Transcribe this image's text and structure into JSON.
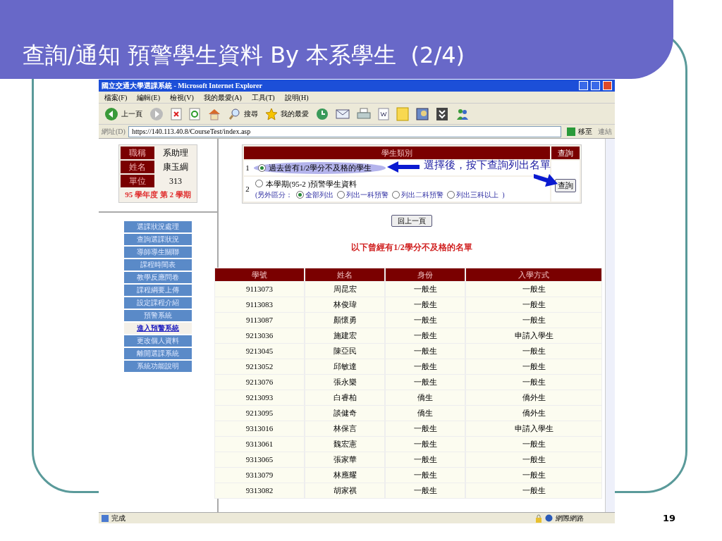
{
  "slide": {
    "title": "查詢/通知 預警學生資料 By 本系學生  (2/4)",
    "page_number": "19"
  },
  "browser": {
    "title": "國立交通大學選課系統 - Microsoft Internet Explorer",
    "menu": [
      "檔案(F)",
      "編輯(E)",
      "檢視(V)",
      "我的最愛(A)",
      "工具(T)",
      "說明(H)"
    ],
    "toolbar": [
      {
        "kind": "back",
        "label": "上一頁"
      },
      {
        "kind": "forward"
      },
      {
        "kind": "stop"
      },
      {
        "kind": "refresh"
      },
      {
        "kind": "home"
      },
      {
        "kind": "search",
        "label": "搜尋"
      },
      {
        "kind": "favorites",
        "label": "我的最愛"
      },
      {
        "kind": "history"
      },
      {
        "kind": "mail"
      },
      {
        "kind": "print"
      },
      {
        "kind": "edit"
      },
      {
        "kind": "note"
      },
      {
        "kind": "research"
      },
      {
        "kind": "save"
      },
      {
        "kind": "messenger"
      }
    ],
    "address_label": "網址(D)",
    "address": "https://140.113.40.8/CourseTest/index.asp",
    "go": "移至",
    "links": "連結",
    "status": "完成",
    "zone": "網際網路"
  },
  "info": {
    "rows": [
      {
        "label": "職稱",
        "value": "系助理"
      },
      {
        "label": "姓名",
        "value": "康玉綢"
      },
      {
        "label": "單位",
        "value": "313"
      }
    ],
    "term": "95 學年度 第 2 學期"
  },
  "nav": [
    {
      "label": "選課狀況處理",
      "selected": false
    },
    {
      "label": "查詢選課狀況",
      "selected": false
    },
    {
      "label": "導師導生關聯",
      "selected": false
    },
    {
      "label": "課程時間表",
      "selected": false
    },
    {
      "label": "教學反應問卷",
      "selected": false
    },
    {
      "label": "課程綱要上傳",
      "selected": false
    },
    {
      "label": "設定課程介紹",
      "selected": false
    },
    {
      "label": "預警系統",
      "selected": false
    },
    {
      "label": "進入預警系統",
      "selected": true
    },
    {
      "label": "更改個人資料",
      "selected": false
    },
    {
      "label": "離開選課系統",
      "selected": false
    },
    {
      "label": "系統功能說明",
      "selected": false
    }
  ],
  "query": {
    "header": "學生類別",
    "action_header": "查詢",
    "button": "查詢",
    "options": [
      {
        "index": "1",
        "label": "過去曾有1/2學分不及格的學生",
        "selected": true,
        "highlighted": true
      },
      {
        "index": "2",
        "label": "本學期(95-2 )預警學生資料",
        "selected": false,
        "highlighted": false
      }
    ],
    "sub_prefix": "(另外區分：",
    "sub_suffix": ")",
    "sub_options": [
      {
        "label": "全部列出",
        "selected": true
      },
      {
        "label": "列出一科預警",
        "selected": false
      },
      {
        "label": "列出二科預警",
        "selected": false
      },
      {
        "label": "列出三科以上",
        "selected": false
      }
    ],
    "annotation": "選擇後，按下查詢列出名單"
  },
  "back_button": "回上一頁",
  "list_title": "以下曾經有1/2學分不及格的名單",
  "table": {
    "columns": [
      "學號",
      "姓名",
      "身份",
      "入學方式"
    ],
    "rows": [
      [
        "9113073",
        "周昆宏",
        "一般生",
        "一般生"
      ],
      [
        "9113083",
        "林俊瑋",
        "一般生",
        "一般生"
      ],
      [
        "9113087",
        "顏懷勇",
        "一般生",
        "一般生"
      ],
      [
        "9213036",
        "施建宏",
        "一般生",
        "申請入學生"
      ],
      [
        "9213045",
        "陳亞民",
        "一般生",
        "一般生"
      ],
      [
        "9213052",
        "邱敏達",
        "一般生",
        "一般生"
      ],
      [
        "9213076",
        "張永樂",
        "一般生",
        "一般生"
      ],
      [
        "9213093",
        "白睿柏",
        "僑生",
        "僑外生"
      ],
      [
        "9213095",
        "談健奇",
        "僑生",
        "僑外生"
      ],
      [
        "9313016",
        "林保言",
        "一般生",
        "申請入學生"
      ],
      [
        "9313061",
        "魏宏憲",
        "一般生",
        "一般生"
      ],
      [
        "9313065",
        "張家華",
        "一般生",
        "一般生"
      ],
      [
        "9313079",
        "林應耀",
        "一般生",
        "一般生"
      ],
      [
        "9313082",
        "胡家祺",
        "一般生",
        "一般生"
      ]
    ]
  }
}
